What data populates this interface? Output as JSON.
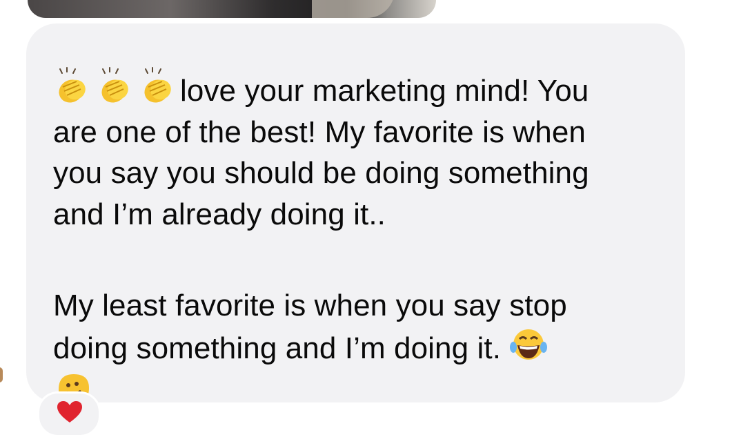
{
  "message": {
    "line1_text": "love your marketing mind! You",
    "line2": "are one of the best!  My favorite is when",
    "line3": "you say you should be doing something",
    "line4": "and I’m already doing it..",
    "line5": "My least favorite is when you say stop",
    "line6_text": "doing something and I’m doing it.",
    "leading_emojis": [
      "clapping-hands-emoji",
      "clapping-hands-emoji",
      "clapping-hands-emoji"
    ],
    "trailing_emojis": [
      "tears-of-joy-emoji",
      "melting-face-emoji"
    ]
  },
  "reaction": {
    "icon": "red-heart-icon",
    "color": "#e0242f"
  },
  "colors": {
    "bubble": "#f2f2f4",
    "text": "#0a0a0a"
  }
}
